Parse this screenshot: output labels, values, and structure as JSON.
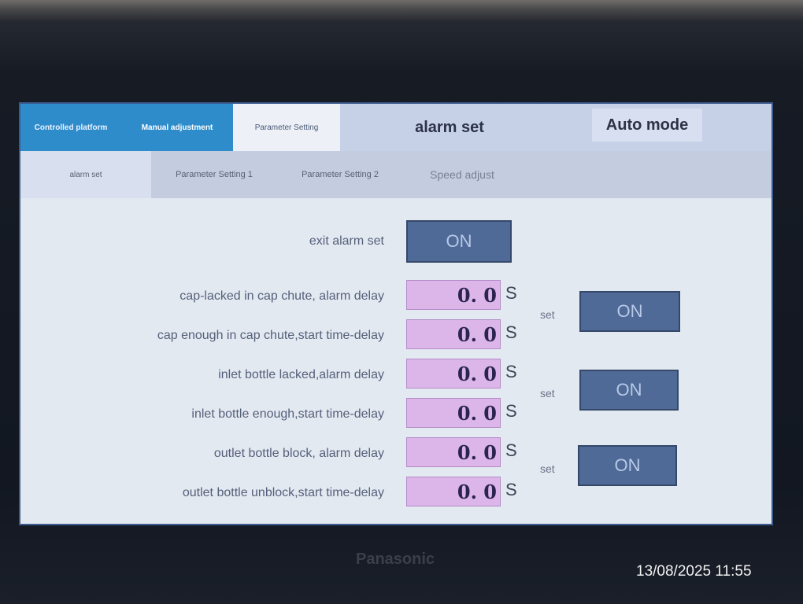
{
  "tabs": {
    "controlled_platform": "Controlled platform",
    "manual_adjustment": "Manual adjustment",
    "parameter_setting": "Parameter Setting"
  },
  "header": {
    "title": "alarm set",
    "mode": "Auto mode"
  },
  "subtabs": [
    "alarm set",
    "Parameter Setting 1",
    "Parameter Setting 2",
    "Speed adjust"
  ],
  "exit_alarm": {
    "label": "exit alarm set",
    "button": "ON"
  },
  "rows": [
    {
      "label": "cap-lacked in cap chute, alarm delay",
      "value": "0. 0",
      "unit": "S"
    },
    {
      "label": "cap enough in cap chute,start time-delay",
      "value": "0. 0",
      "unit": "S"
    },
    {
      "label": "inlet bottle lacked,alarm delay",
      "value": "0. 0",
      "unit": "S"
    },
    {
      "label": "inlet bottle enough,start time-delay",
      "value": "0. 0",
      "unit": "S"
    },
    {
      "label": "outlet bottle block, alarm delay",
      "value": "0. 0",
      "unit": "S"
    },
    {
      "label": "outlet bottle unblock,start time-delay",
      "value": "0. 0",
      "unit": "S"
    }
  ],
  "set_groups": [
    {
      "label": "set",
      "button": "ON"
    },
    {
      "label": "set",
      "button": "ON"
    },
    {
      "label": "set",
      "button": "ON"
    }
  ],
  "device": {
    "brand": "Panasonic"
  },
  "photo_timestamp": "13/08/2025 11:55"
}
